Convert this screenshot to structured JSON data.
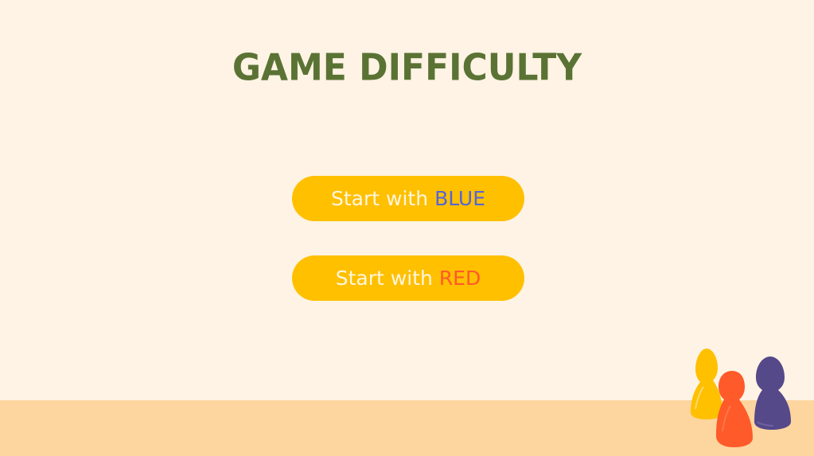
{
  "title": "GAME DIFFICULTY",
  "buttons": {
    "blue": {
      "prefix": "Start with",
      "color_word": "BLUE"
    },
    "red": {
      "prefix": "Start with",
      "color_word": "RED"
    }
  },
  "colors": {
    "background": "#fef3e4",
    "floor": "#fdd59e",
    "title": "#5a7334",
    "button": "#ffc000",
    "blue_text": "#5565d8",
    "red_text": "#ff5a2a"
  },
  "decoration": {
    "pawns": [
      "yellow-pawn-icon",
      "red-pawn-icon",
      "blue-pawn-icon"
    ]
  }
}
